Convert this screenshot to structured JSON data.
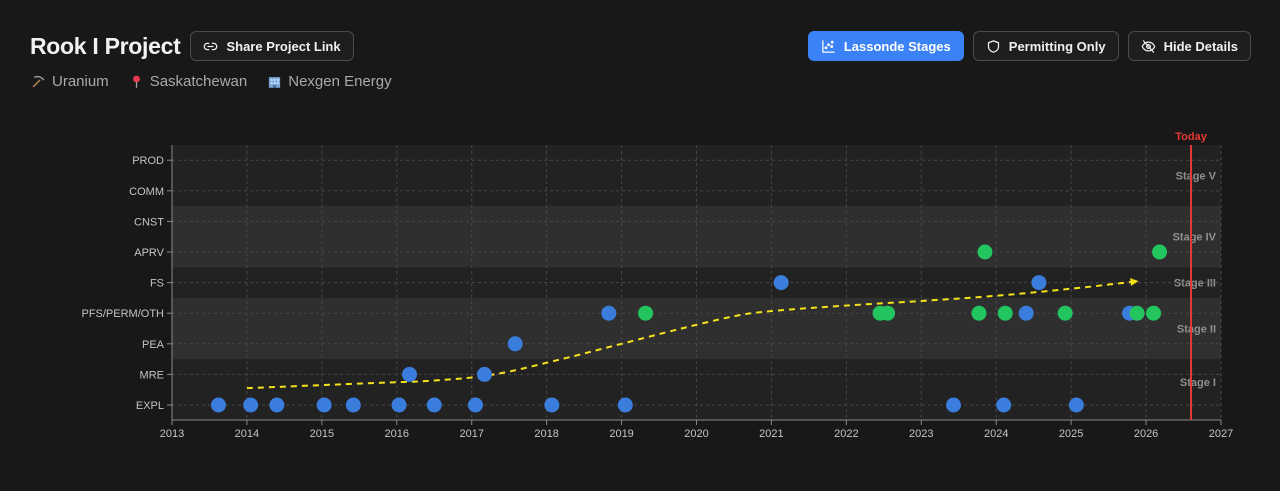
{
  "header": {
    "title": "Rook I Project",
    "share_label": "Share Project Link"
  },
  "meta": {
    "commodity": "Uranium",
    "location": "Saskatchewan",
    "company": "Nexgen Energy"
  },
  "actions": {
    "lassonde_label": "Lassonde Stages",
    "permitting_label": "Permitting Only",
    "hide_details_label": "Hide Details"
  },
  "colors": {
    "accent": "#3b82f6",
    "blue_point": "#3b7ddd",
    "green_point": "#22c55e",
    "today_line": "#e53935",
    "trend": "#f5e11b"
  },
  "chart_data": {
    "type": "scatter",
    "x_ticks": [
      2013,
      2014,
      2015,
      2016,
      2017,
      2018,
      2019,
      2020,
      2021,
      2022,
      2023,
      2024,
      2025,
      2026,
      2027
    ],
    "xlim": [
      2013,
      2027
    ],
    "y_categories": [
      "EXPL",
      "MRE",
      "PEA",
      "PFS/PERM/OTH",
      "FS",
      "APRV",
      "CNST",
      "COMM",
      "PROD"
    ],
    "grid": true,
    "stage_bands": [
      {
        "label": "Stage I",
        "from": 0,
        "to": 1.5,
        "shaded": false
      },
      {
        "label": "Stage II",
        "from": 1.5,
        "to": 3.5,
        "shaded": true
      },
      {
        "label": "Stage III",
        "from": 3.5,
        "to": 4.5,
        "shaded": false
      },
      {
        "label": "Stage IV",
        "from": 4.5,
        "to": 6.5,
        "shaded": true
      },
      {
        "label": "Stage V",
        "from": 6.5,
        "to": 8.5,
        "shaded": false
      }
    ],
    "today": {
      "label": "Today",
      "x": 2026.6
    },
    "series": [
      {
        "color": "blue",
        "points": [
          {
            "x": 2013.62,
            "y": "EXPL"
          },
          {
            "x": 2014.05,
            "y": "EXPL"
          },
          {
            "x": 2014.4,
            "y": "EXPL"
          },
          {
            "x": 2015.03,
            "y": "EXPL"
          },
          {
            "x": 2015.42,
            "y": "EXPL"
          },
          {
            "x": 2016.03,
            "y": "EXPL"
          },
          {
            "x": 2016.5,
            "y": "EXPL"
          },
          {
            "x": 2017.05,
            "y": "EXPL"
          },
          {
            "x": 2018.07,
            "y": "EXPL"
          },
          {
            "x": 2019.05,
            "y": "EXPL"
          },
          {
            "x": 2023.43,
            "y": "EXPL"
          },
          {
            "x": 2024.1,
            "y": "EXPL"
          },
          {
            "x": 2025.07,
            "y": "EXPL"
          },
          {
            "x": 2016.17,
            "y": "MRE"
          },
          {
            "x": 2017.17,
            "y": "MRE"
          },
          {
            "x": 2017.58,
            "y": "PEA"
          },
          {
            "x": 2018.83,
            "y": "PFS/PERM/OTH"
          },
          {
            "x": 2024.4,
            "y": "PFS/PERM/OTH"
          },
          {
            "x": 2025.78,
            "y": "PFS/PERM/OTH"
          },
          {
            "x": 2021.13,
            "y": "FS"
          },
          {
            "x": 2024.57,
            "y": "FS"
          }
        ]
      },
      {
        "color": "green",
        "points": [
          {
            "x": 2019.32,
            "y": "PFS/PERM/OTH"
          },
          {
            "x": 2022.45,
            "y": "PFS/PERM/OTH"
          },
          {
            "x": 2022.55,
            "y": "PFS/PERM/OTH"
          },
          {
            "x": 2023.77,
            "y": "PFS/PERM/OTH"
          },
          {
            "x": 2024.12,
            "y": "PFS/PERM/OTH"
          },
          {
            "x": 2024.92,
            "y": "PFS/PERM/OTH"
          },
          {
            "x": 2025.88,
            "y": "PFS/PERM/OTH"
          },
          {
            "x": 2026.1,
            "y": "PFS/PERM/OTH"
          },
          {
            "x": 2023.85,
            "y": "APRV"
          },
          {
            "x": 2026.18,
            "y": "APRV"
          }
        ]
      }
    ],
    "trend": {
      "style": "dashed-arrow",
      "points": [
        {
          "x": 2014.0,
          "y": 0.55
        },
        {
          "x": 2015.5,
          "y": 0.7
        },
        {
          "x": 2016.5,
          "y": 0.8
        },
        {
          "x": 2017.3,
          "y": 1.0
        },
        {
          "x": 2018.2,
          "y": 1.5
        },
        {
          "x": 2019.0,
          "y": 2.0
        },
        {
          "x": 2019.8,
          "y": 2.5
        },
        {
          "x": 2020.5,
          "y": 2.9
        },
        {
          "x": 2021.0,
          "y": 3.07
        },
        {
          "x": 2022.0,
          "y": 3.25
        },
        {
          "x": 2023.0,
          "y": 3.4
        },
        {
          "x": 2024.0,
          "y": 3.57
        },
        {
          "x": 2025.0,
          "y": 3.8
        },
        {
          "x": 2025.9,
          "y": 4.05
        }
      ]
    }
  }
}
